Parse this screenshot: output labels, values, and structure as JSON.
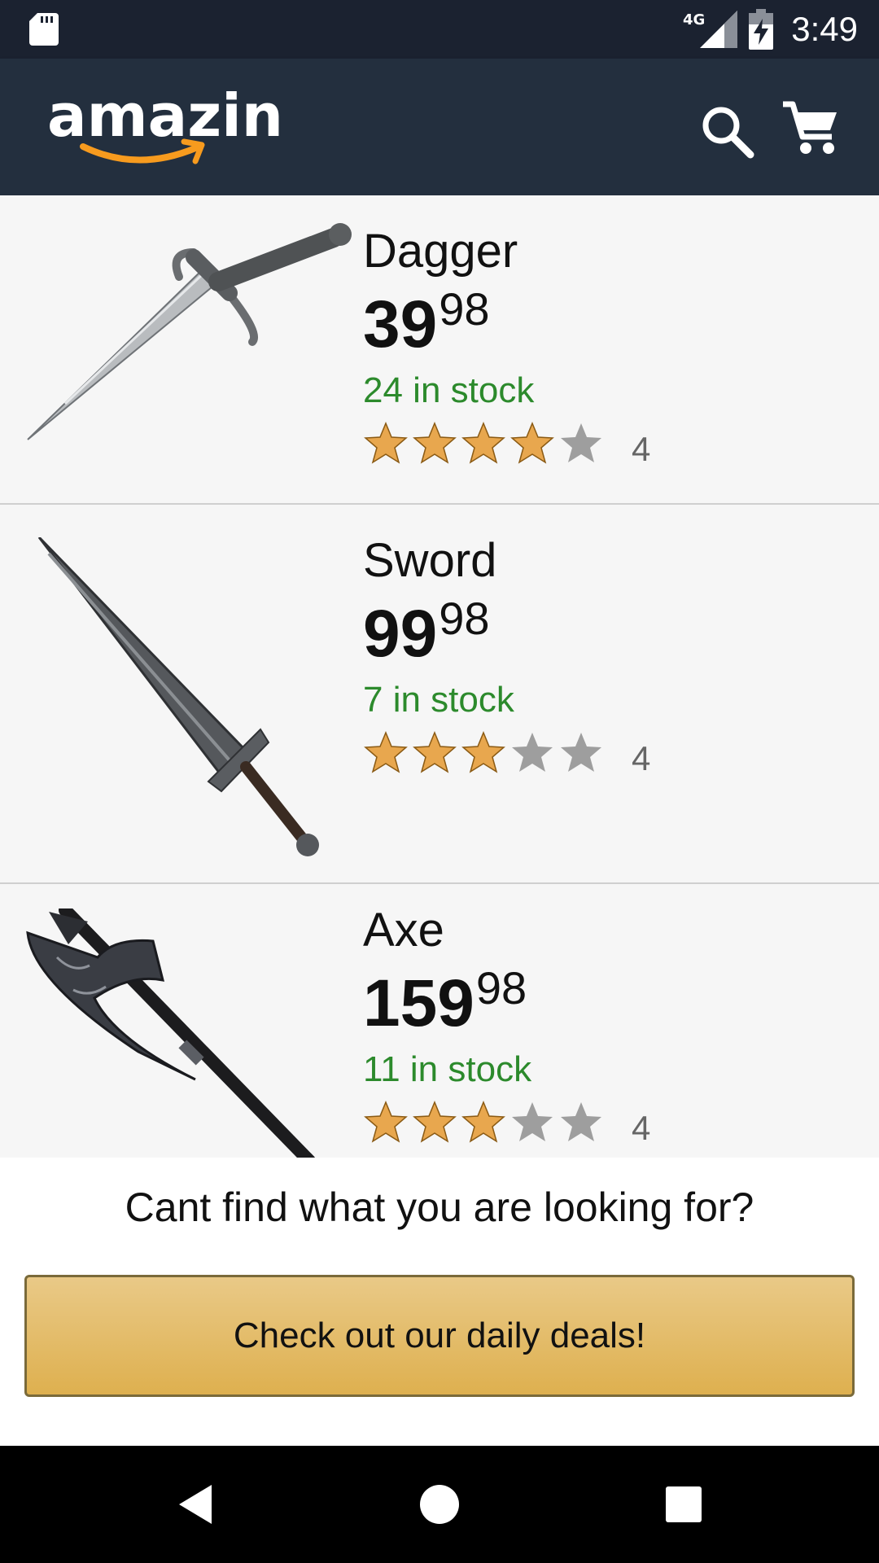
{
  "status_bar": {
    "network": "4G",
    "time": "3:49",
    "icons": [
      "sd-card-icon",
      "signal-icon",
      "battery-charging-icon"
    ]
  },
  "app_bar": {
    "logo_text": "amazin",
    "icons": [
      "search-icon",
      "cart-icon"
    ],
    "colors": {
      "background": "#232f3e",
      "logo_smile": "#f79b1e"
    }
  },
  "products": [
    {
      "name": "Dagger",
      "price_whole": "39",
      "price_fraction": "98",
      "stock": "24 in stock",
      "stars_filled": 4,
      "stars_total": 5,
      "rating_count": "4"
    },
    {
      "name": "Sword",
      "price_whole": "99",
      "price_fraction": "98",
      "stock": "7 in stock",
      "stars_filled": 3,
      "stars_total": 5,
      "rating_count": "4"
    },
    {
      "name": "Axe",
      "price_whole": "159",
      "price_fraction": "98",
      "stock": "11 in stock",
      "stars_filled": 3,
      "stars_total": 5,
      "rating_count": "4"
    }
  ],
  "footer": {
    "question": "Cant find what you are looking for?",
    "button_label": "Check out our daily deals!"
  },
  "colors": {
    "status_bar": "#1b2230",
    "stock_text": "#2c8a2c",
    "star_filled": "#e8a74e",
    "star_empty": "#9e9e9e",
    "button_gradient_top": "#e9c987",
    "button_gradient_bottom": "#deb04f"
  }
}
